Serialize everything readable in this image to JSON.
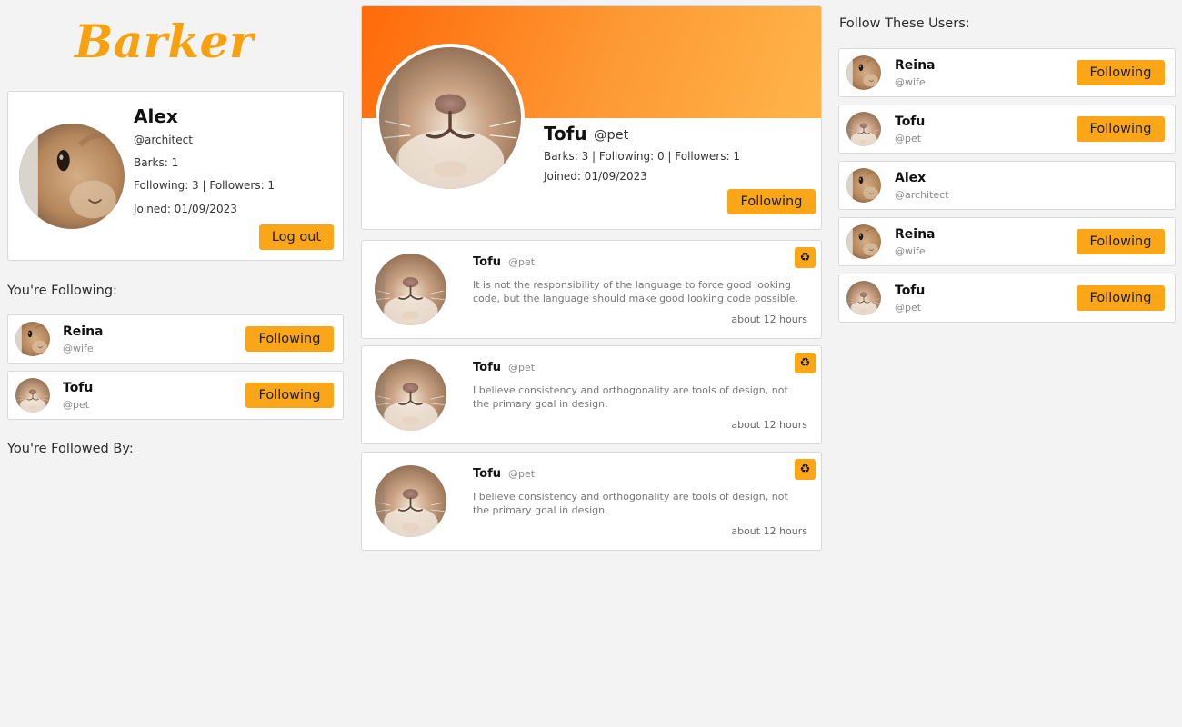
{
  "app": {
    "logo": "Barker"
  },
  "me": {
    "name": "Alex",
    "handle": "@architect",
    "barks": "Barks: 1",
    "follow_stats": "Following: 3 | Followers: 1",
    "joined": "Joined: 01/09/2023",
    "logout_label": "Log out"
  },
  "following": {
    "title": "You're Following:",
    "users": [
      {
        "name": "Reina",
        "handle": "@wife",
        "button": "Following"
      },
      {
        "name": "Tofu",
        "handle": "@pet",
        "button": "Following"
      }
    ]
  },
  "followed_by": {
    "title": "You're Followed By:"
  },
  "profile": {
    "name": "Tofu",
    "handle": "@pet",
    "stats": "Barks: 3 | Following: 0 | Followers: 1",
    "joined": "Joined: 01/09/2023",
    "button": "Following"
  },
  "posts": [
    {
      "author": "Tofu",
      "handle": "@pet",
      "text": "It is not the responsibility of the language to force good looking code, but the language should make good looking code possible.",
      "time": "about 12 hours",
      "rebark_icon": "♻"
    },
    {
      "author": "Tofu",
      "handle": "@pet",
      "text": "I believe consistency and orthogonality are tools of design, not the primary goal in design.",
      "time": "about 12 hours",
      "rebark_icon": "♻"
    },
    {
      "author": "Tofu",
      "handle": "@pet",
      "text": "I believe consistency and orthogonality are tools of design, not the primary goal in design.",
      "time": "about 12 hours",
      "rebark_icon": "♻"
    }
  ],
  "suggestions": {
    "title": "Follow These Users:",
    "users": [
      {
        "name": "Reina",
        "handle": "@wife",
        "button": "Following"
      },
      {
        "name": "Tofu",
        "handle": "@pet",
        "button": "Following"
      },
      {
        "name": "Alex",
        "handle": "@architect"
      },
      {
        "name": "Reina",
        "handle": "@wife",
        "button": "Following"
      },
      {
        "name": "Tofu",
        "handle": "@pet",
        "button": "Following"
      }
    ]
  },
  "colors": {
    "accent": "#fba619",
    "banner_start": "#ff6a0a",
    "banner_end": "#ffb54a",
    "background": "#f3f3f3"
  }
}
